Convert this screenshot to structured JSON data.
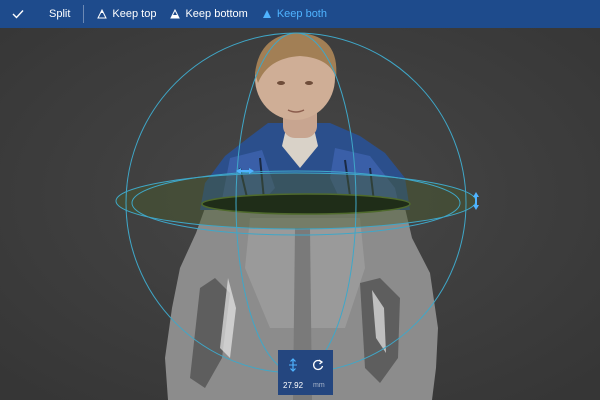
{
  "toolbar": {
    "confirm_icon": "checkmark-icon",
    "split_label": "Split",
    "keep_top_label": "Keep top",
    "keep_bottom_label": "Keep bottom",
    "keep_both_label": "Keep both",
    "active_item": "Keep both"
  },
  "panel": {
    "value": "27.92",
    "unit": "mm",
    "move_icon": "vertical-move-icon",
    "reset_icon": "rotate-reset-icon"
  },
  "colors": {
    "toolbar_bg": "#1e4b8c",
    "accent": "#4fb3ff",
    "canvas_bg": "#3c3c3c",
    "gizmo": "#3fa7c8",
    "panel_bg": "#24467f"
  }
}
